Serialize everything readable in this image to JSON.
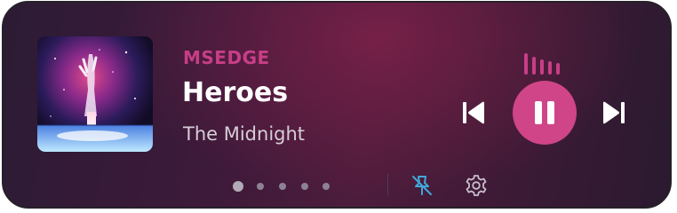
{
  "media": {
    "app_name": "MSEDGE",
    "title": "Heroes",
    "artist": "The Midnight",
    "playback_state": "playing"
  },
  "controls": {
    "previous_icon": "skip-previous-icon",
    "play_pause_icon": "pause-icon",
    "next_icon": "skip-next-icon",
    "equalizer_icon": "audio-bars-icon"
  },
  "footer": {
    "page_count": 5,
    "active_page": 1,
    "pin_icon": "unpin-icon",
    "settings_icon": "gear-icon"
  },
  "colors": {
    "accent": "#c73e87",
    "play_button": "#cf4588",
    "pin_icon": "#3fa9d9",
    "title_text": "#ffffff",
    "artist_text": "#d6cdd8"
  }
}
